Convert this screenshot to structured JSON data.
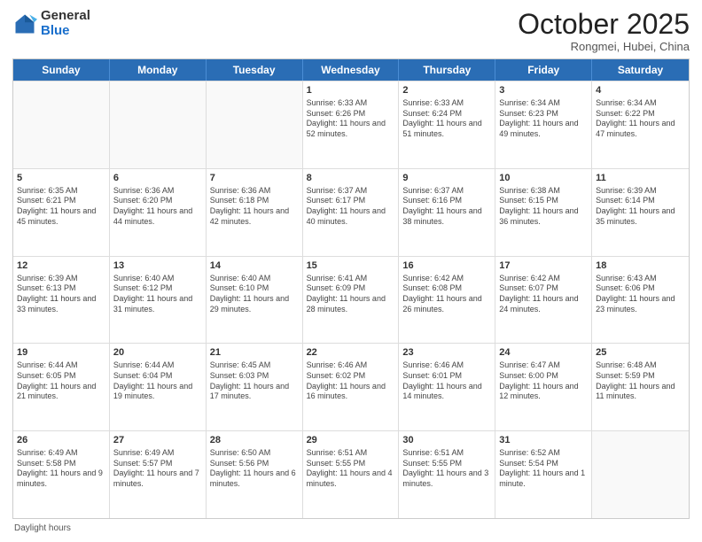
{
  "logo": {
    "general": "General",
    "blue": "Blue"
  },
  "header": {
    "month": "October 2025",
    "location": "Rongmei, Hubei, China"
  },
  "days": [
    "Sunday",
    "Monday",
    "Tuesday",
    "Wednesday",
    "Thursday",
    "Friday",
    "Saturday"
  ],
  "weeks": [
    [
      {
        "day": "",
        "sunrise": "",
        "sunset": "",
        "daylight": ""
      },
      {
        "day": "",
        "sunrise": "",
        "sunset": "",
        "daylight": ""
      },
      {
        "day": "",
        "sunrise": "",
        "sunset": "",
        "daylight": ""
      },
      {
        "day": "1",
        "sunrise": "Sunrise: 6:33 AM",
        "sunset": "Sunset: 6:26 PM",
        "daylight": "Daylight: 11 hours and 52 minutes."
      },
      {
        "day": "2",
        "sunrise": "Sunrise: 6:33 AM",
        "sunset": "Sunset: 6:24 PM",
        "daylight": "Daylight: 11 hours and 51 minutes."
      },
      {
        "day": "3",
        "sunrise": "Sunrise: 6:34 AM",
        "sunset": "Sunset: 6:23 PM",
        "daylight": "Daylight: 11 hours and 49 minutes."
      },
      {
        "day": "4",
        "sunrise": "Sunrise: 6:34 AM",
        "sunset": "Sunset: 6:22 PM",
        "daylight": "Daylight: 11 hours and 47 minutes."
      }
    ],
    [
      {
        "day": "5",
        "sunrise": "Sunrise: 6:35 AM",
        "sunset": "Sunset: 6:21 PM",
        "daylight": "Daylight: 11 hours and 45 minutes."
      },
      {
        "day": "6",
        "sunrise": "Sunrise: 6:36 AM",
        "sunset": "Sunset: 6:20 PM",
        "daylight": "Daylight: 11 hours and 44 minutes."
      },
      {
        "day": "7",
        "sunrise": "Sunrise: 6:36 AM",
        "sunset": "Sunset: 6:18 PM",
        "daylight": "Daylight: 11 hours and 42 minutes."
      },
      {
        "day": "8",
        "sunrise": "Sunrise: 6:37 AM",
        "sunset": "Sunset: 6:17 PM",
        "daylight": "Daylight: 11 hours and 40 minutes."
      },
      {
        "day": "9",
        "sunrise": "Sunrise: 6:37 AM",
        "sunset": "Sunset: 6:16 PM",
        "daylight": "Daylight: 11 hours and 38 minutes."
      },
      {
        "day": "10",
        "sunrise": "Sunrise: 6:38 AM",
        "sunset": "Sunset: 6:15 PM",
        "daylight": "Daylight: 11 hours and 36 minutes."
      },
      {
        "day": "11",
        "sunrise": "Sunrise: 6:39 AM",
        "sunset": "Sunset: 6:14 PM",
        "daylight": "Daylight: 11 hours and 35 minutes."
      }
    ],
    [
      {
        "day": "12",
        "sunrise": "Sunrise: 6:39 AM",
        "sunset": "Sunset: 6:13 PM",
        "daylight": "Daylight: 11 hours and 33 minutes."
      },
      {
        "day": "13",
        "sunrise": "Sunrise: 6:40 AM",
        "sunset": "Sunset: 6:12 PM",
        "daylight": "Daylight: 11 hours and 31 minutes."
      },
      {
        "day": "14",
        "sunrise": "Sunrise: 6:40 AM",
        "sunset": "Sunset: 6:10 PM",
        "daylight": "Daylight: 11 hours and 29 minutes."
      },
      {
        "day": "15",
        "sunrise": "Sunrise: 6:41 AM",
        "sunset": "Sunset: 6:09 PM",
        "daylight": "Daylight: 11 hours and 28 minutes."
      },
      {
        "day": "16",
        "sunrise": "Sunrise: 6:42 AM",
        "sunset": "Sunset: 6:08 PM",
        "daylight": "Daylight: 11 hours and 26 minutes."
      },
      {
        "day": "17",
        "sunrise": "Sunrise: 6:42 AM",
        "sunset": "Sunset: 6:07 PM",
        "daylight": "Daylight: 11 hours and 24 minutes."
      },
      {
        "day": "18",
        "sunrise": "Sunrise: 6:43 AM",
        "sunset": "Sunset: 6:06 PM",
        "daylight": "Daylight: 11 hours and 23 minutes."
      }
    ],
    [
      {
        "day": "19",
        "sunrise": "Sunrise: 6:44 AM",
        "sunset": "Sunset: 6:05 PM",
        "daylight": "Daylight: 11 hours and 21 minutes."
      },
      {
        "day": "20",
        "sunrise": "Sunrise: 6:44 AM",
        "sunset": "Sunset: 6:04 PM",
        "daylight": "Daylight: 11 hours and 19 minutes."
      },
      {
        "day": "21",
        "sunrise": "Sunrise: 6:45 AM",
        "sunset": "Sunset: 6:03 PM",
        "daylight": "Daylight: 11 hours and 17 minutes."
      },
      {
        "day": "22",
        "sunrise": "Sunrise: 6:46 AM",
        "sunset": "Sunset: 6:02 PM",
        "daylight": "Daylight: 11 hours and 16 minutes."
      },
      {
        "day": "23",
        "sunrise": "Sunrise: 6:46 AM",
        "sunset": "Sunset: 6:01 PM",
        "daylight": "Daylight: 11 hours and 14 minutes."
      },
      {
        "day": "24",
        "sunrise": "Sunrise: 6:47 AM",
        "sunset": "Sunset: 6:00 PM",
        "daylight": "Daylight: 11 hours and 12 minutes."
      },
      {
        "day": "25",
        "sunrise": "Sunrise: 6:48 AM",
        "sunset": "Sunset: 5:59 PM",
        "daylight": "Daylight: 11 hours and 11 minutes."
      }
    ],
    [
      {
        "day": "26",
        "sunrise": "Sunrise: 6:49 AM",
        "sunset": "Sunset: 5:58 PM",
        "daylight": "Daylight: 11 hours and 9 minutes."
      },
      {
        "day": "27",
        "sunrise": "Sunrise: 6:49 AM",
        "sunset": "Sunset: 5:57 PM",
        "daylight": "Daylight: 11 hours and 7 minutes."
      },
      {
        "day": "28",
        "sunrise": "Sunrise: 6:50 AM",
        "sunset": "Sunset: 5:56 PM",
        "daylight": "Daylight: 11 hours and 6 minutes."
      },
      {
        "day": "29",
        "sunrise": "Sunrise: 6:51 AM",
        "sunset": "Sunset: 5:55 PM",
        "daylight": "Daylight: 11 hours and 4 minutes."
      },
      {
        "day": "30",
        "sunrise": "Sunrise: 6:51 AM",
        "sunset": "Sunset: 5:55 PM",
        "daylight": "Daylight: 11 hours and 3 minutes."
      },
      {
        "day": "31",
        "sunrise": "Sunrise: 6:52 AM",
        "sunset": "Sunset: 5:54 PM",
        "daylight": "Daylight: 11 hours and 1 minute."
      },
      {
        "day": "",
        "sunrise": "",
        "sunset": "",
        "daylight": ""
      }
    ]
  ],
  "footer": {
    "label": "Daylight hours"
  }
}
